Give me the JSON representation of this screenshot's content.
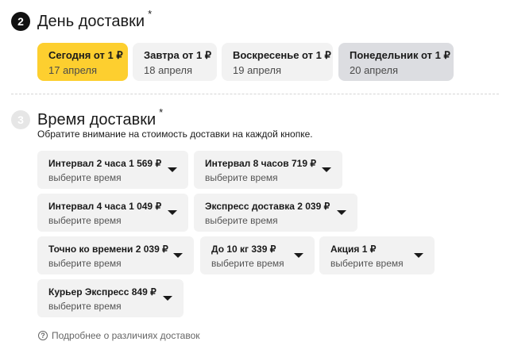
{
  "delivery_day": {
    "step": "2",
    "title": "День доставки",
    "required_mark": "*",
    "options": [
      {
        "title": "Сегодня от 1 ₽",
        "date": "17 апреля"
      },
      {
        "title": "Завтра от 1 ₽",
        "date": "18 апреля"
      },
      {
        "title": "Воскресенье от 1 ₽",
        "date": "19 апреля"
      },
      {
        "title": "Понедельник от 1 ₽",
        "date": "20 апреля"
      }
    ]
  },
  "delivery_time": {
    "step": "3",
    "title": "Время доставки",
    "required_mark": "*",
    "note": "Обратите внимание на стоимость доставки на каждой кнопке.",
    "intervals": [
      {
        "title": "Интервал 2 часа 1 569 ₽",
        "hint": "выберите время"
      },
      {
        "title": "Интервал 8 часов 719 ₽",
        "hint": "выберите время"
      },
      {
        "title": "Интервал 4 часа 1 049 ₽",
        "hint": "выберите время"
      },
      {
        "title": "Экспресс доставка 2 039 ₽",
        "hint": "выберите время"
      },
      {
        "title": "Точно ко времени 2 039 ₽",
        "hint": "выберите время"
      },
      {
        "title": "До 10 кг 339 ₽",
        "hint": "выберите время"
      },
      {
        "title": "Акция 1 ₽",
        "hint": "выберите время"
      },
      {
        "title": "Курьер Экспресс 849 ₽",
        "hint": "выберите время"
      }
    ],
    "more_info_link": "Подробнее о различиях доставок"
  },
  "colors": {
    "selected": "#fdcf2f",
    "option_bg": "#f2f2f2",
    "disabled_bg": "#dcdde1"
  },
  "icons": {
    "more_info": "question-circle-icon",
    "dropdown": "caret-down-icon"
  }
}
